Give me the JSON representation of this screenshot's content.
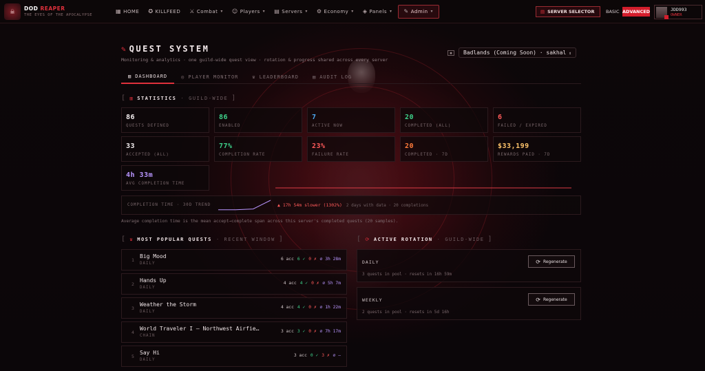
{
  "brand": {
    "title_a": "DOD",
    "title_b": "REAPER",
    "subtitle": "THE EYES OF THE APOCALYPSE",
    "mark": "☠"
  },
  "nav": [
    {
      "icon": "▦",
      "label": "HOME",
      "chev": false
    },
    {
      "icon": "✪",
      "label": "KILLFEED",
      "chev": false
    },
    {
      "icon": "⚔",
      "label": "Combat",
      "chev": true
    },
    {
      "icon": "☺",
      "label": "Players",
      "chev": true
    },
    {
      "icon": "▤",
      "label": "Servers",
      "chev": true
    },
    {
      "icon": "⚙",
      "label": "Economy",
      "chev": true
    },
    {
      "icon": "◈",
      "label": "Panels",
      "chev": true
    },
    {
      "icon": "✎",
      "label": "Admin",
      "chev": true
    }
  ],
  "topright": {
    "server_selector": "SERVER SELECTOR",
    "basic": "BASIC",
    "advanced": "ADVANCED",
    "user_name": "JDD993",
    "user_role": "OWNER"
  },
  "page": {
    "title": "QUEST SYSTEM",
    "subtitle": "Monitoring & analytics · one guild-wide quest view · rotation & progress shared across every server",
    "server": "Badlands (Coming Soon) · sakhal"
  },
  "tabs": [
    {
      "icon": "▥",
      "label": "DASHBOARD",
      "active": true
    },
    {
      "icon": "◎",
      "label": "PLAYER MONITOR",
      "active": false
    },
    {
      "icon": "♛",
      "label": "LEADERBOARD",
      "active": false
    },
    {
      "icon": "▤",
      "label": "AUDIT LOG",
      "active": false
    }
  ],
  "statistics": {
    "title": "STATISTICS",
    "tag": "GUILD-WIDE"
  },
  "cards": [
    {
      "value": "86",
      "label": "QUESTS DEFINED",
      "color": "white"
    },
    {
      "value": "86",
      "label": "ENABLED",
      "color": "green"
    },
    {
      "value": "7",
      "label": "ACTIVE NOW",
      "color": "blue"
    },
    {
      "value": "20",
      "label": "COMPLETED (ALL)",
      "color": "green"
    },
    {
      "value": "6",
      "label": "FAILED / EXPIRED",
      "color": "red"
    },
    {
      "value": "33",
      "label": "ACCEPTED (ALL)",
      "color": "white"
    },
    {
      "value": "77%",
      "label": "COMPLETION RATE",
      "color": "green"
    },
    {
      "value": "23%",
      "label": "FAILURE RATE",
      "color": "red"
    },
    {
      "value": "20",
      "label": "COMPLETED · 7D",
      "color": "orange"
    },
    {
      "value": "$33,199",
      "label": "REWARDS PAID · 7D",
      "color": "gold"
    },
    {
      "value": "4h 33m",
      "label": "AVG COMPLETION TIME",
      "color": "purple"
    }
  ],
  "trend": {
    "label": "COMPLETION TIME · 30D TREND",
    "delta": "▲ 17h 54m slower (1302%)",
    "info": "2 days with data · 20 completions",
    "points": [
      0.02,
      0.02,
      0.1,
      1.0
    ]
  },
  "note": "Average completion time is the mean accept→complete span across this server's completed quests (20 samples).",
  "popular": {
    "title": "MOST POPULAR QUESTS",
    "tag": "RECENT WINDOW"
  },
  "quests": [
    {
      "n": "1",
      "name": "Big Mood",
      "type": "DAILY",
      "acc": "6 acc",
      "ok": "6 ✓",
      "x": "0 ✗",
      "t": "⌀ 3h 28m"
    },
    {
      "n": "2",
      "name": "Hands Up",
      "type": "DAILY",
      "acc": "4 acc",
      "ok": "4 ✓",
      "x": "0 ✗",
      "t": "⌀ 5h 7m"
    },
    {
      "n": "3",
      "name": "Weather the Storm",
      "type": "DAILY",
      "acc": "4 acc",
      "ok": "4 ✓",
      "x": "0 ✗",
      "t": "⌀ 1h 22m"
    },
    {
      "n": "4",
      "name": "World Traveler I — Northwest Airfie…",
      "type": "CHAIN",
      "acc": "3 acc",
      "ok": "3 ✓",
      "x": "0 ✗",
      "t": "⌀ 7h 17m"
    },
    {
      "n": "5",
      "name": "Say Hi",
      "type": "DAILY",
      "acc": "3 acc",
      "ok": "0 ✓",
      "x": "3 ✗",
      "t": "⌀ —"
    }
  ],
  "rotation": {
    "title": "ACTIVE ROTATION",
    "tag": "GUILD-WIDE",
    "button": "Regenerate",
    "items": [
      {
        "h": "DAILY",
        "d": "3 quests in pool · resets in 16h 59m"
      },
      {
        "h": "WEEKLY",
        "d": "2 quests in pool · resets in 5d 16h"
      }
    ]
  },
  "colors": {
    "accent": "#e0303c",
    "green": "#3ed18a",
    "blue": "#4da8f0",
    "red": "#ff5a5a",
    "orange": "#ff7b3a",
    "gold": "#ffc46b",
    "purple": "#b996ff",
    "white": "#f2ecee"
  }
}
